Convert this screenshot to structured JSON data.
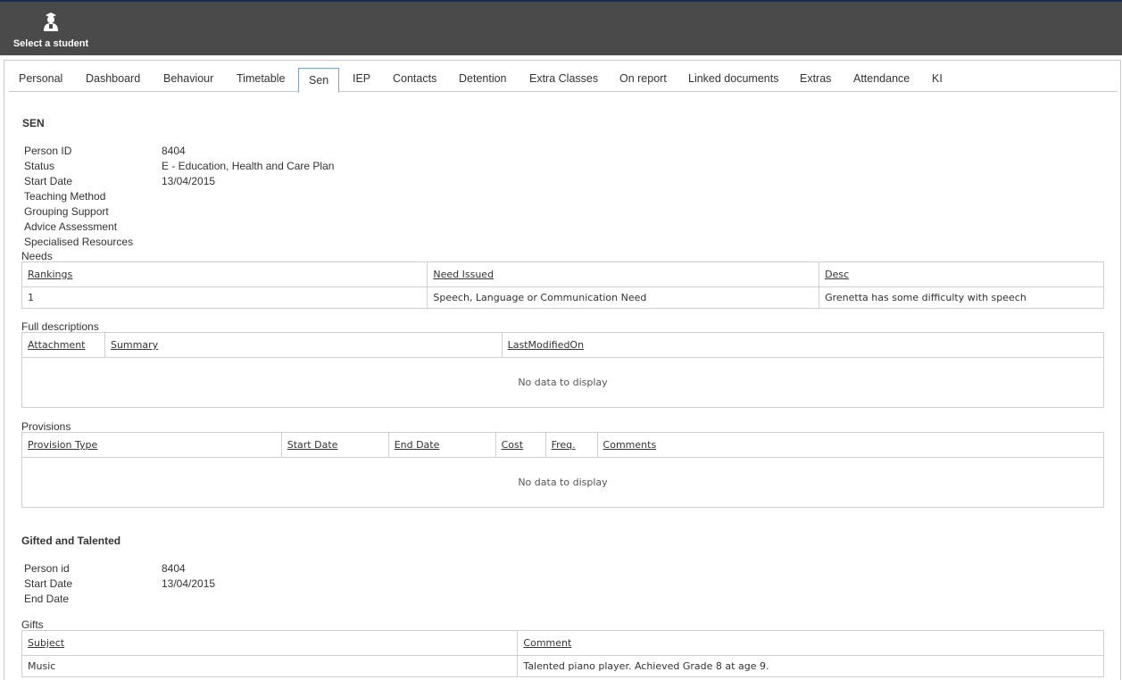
{
  "header": {
    "select_student_label": "Select a student",
    "icon": "student-icon"
  },
  "tabs": [
    {
      "label": "Personal",
      "active": false
    },
    {
      "label": "Dashboard",
      "active": false
    },
    {
      "label": "Behaviour",
      "active": false
    },
    {
      "label": "Timetable",
      "active": false
    },
    {
      "label": "Sen",
      "active": true
    },
    {
      "label": "IEP",
      "active": false
    },
    {
      "label": "Contacts",
      "active": false
    },
    {
      "label": "Detention",
      "active": false
    },
    {
      "label": "Extra Classes",
      "active": false
    },
    {
      "label": "On report",
      "active": false
    },
    {
      "label": "Linked documents",
      "active": false
    },
    {
      "label": "Extras",
      "active": false
    },
    {
      "label": "Attendance",
      "active": false
    },
    {
      "label": "KI",
      "active": false
    }
  ],
  "sen": {
    "title": "SEN",
    "fields": [
      {
        "label": "Person ID",
        "value": "8404"
      },
      {
        "label": "Status",
        "value": "E - Education, Health and Care Plan"
      },
      {
        "label": "Start Date",
        "value": "13/04/2015"
      },
      {
        "label": "Teaching Method",
        "value": ""
      },
      {
        "label": "Grouping Support",
        "value": ""
      },
      {
        "label": "Advice Assessment",
        "value": ""
      },
      {
        "label": "Specialised Resources",
        "value": ""
      }
    ],
    "needs": {
      "caption": "Needs",
      "columns": [
        "Rankings",
        "Need Issued",
        "Desc"
      ],
      "rows": [
        [
          "1",
          "Speech, Language or Communication Need",
          "Grenetta has some difficulty with speech"
        ]
      ]
    },
    "full_descriptions": {
      "caption": "Full descriptions",
      "columns": [
        "Attachment",
        "Summary",
        "LastModifiedOn"
      ],
      "empty_text": "No data to display"
    },
    "provisions": {
      "caption": "Provisions",
      "columns": [
        "Provision Type",
        "Start Date",
        "End Date",
        "Cost",
        "Freq.",
        "Comments"
      ],
      "empty_text": "No data to display"
    }
  },
  "gifted": {
    "title": "Gifted and Talented",
    "fields": [
      {
        "label": "Person id",
        "value": "8404"
      },
      {
        "label": "Start Date",
        "value": "13/04/2015"
      },
      {
        "label": "End Date",
        "value": ""
      }
    ],
    "gifts": {
      "caption": "Gifts",
      "columns": [
        "Subject",
        "Comment"
      ],
      "rows": [
        [
          "Music",
          "Talented piano player. Achieved Grade 8 at age 9."
        ]
      ]
    }
  }
}
